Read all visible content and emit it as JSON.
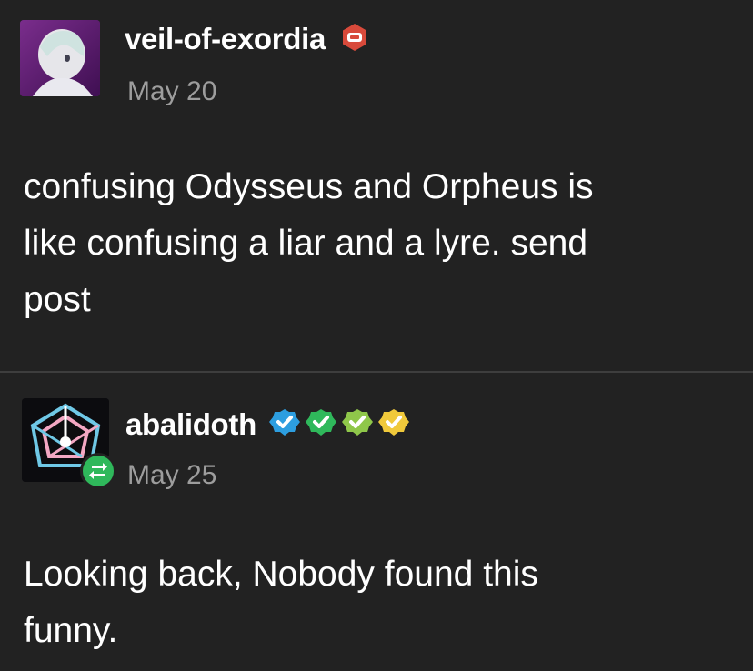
{
  "posts": [
    {
      "username": "veil-of-exordia",
      "date": "May 20",
      "badge_icon": "red-hexagon-badge-icon",
      "badge_color": "#d84a3b",
      "body_lines": [
        "confusing Odysseus and Orpheus is",
        "like confusing a liar and a lyre. send",
        "post"
      ]
    },
    {
      "username": "abalidoth",
      "date": "May 25",
      "badges": [
        {
          "icon": "verified-check-badge-icon",
          "color": "#2d9ee0"
        },
        {
          "icon": "verified-check-badge-icon",
          "color": "#2fb85b"
        },
        {
          "icon": "verified-check-badge-icon",
          "color": "#8fc74a"
        },
        {
          "icon": "verified-check-badge-icon",
          "color": "#f0c93b"
        }
      ],
      "reblog_icon": "reblog-icon",
      "body_lines": [
        "Looking back, Nobody found this",
        "funny."
      ]
    }
  ]
}
